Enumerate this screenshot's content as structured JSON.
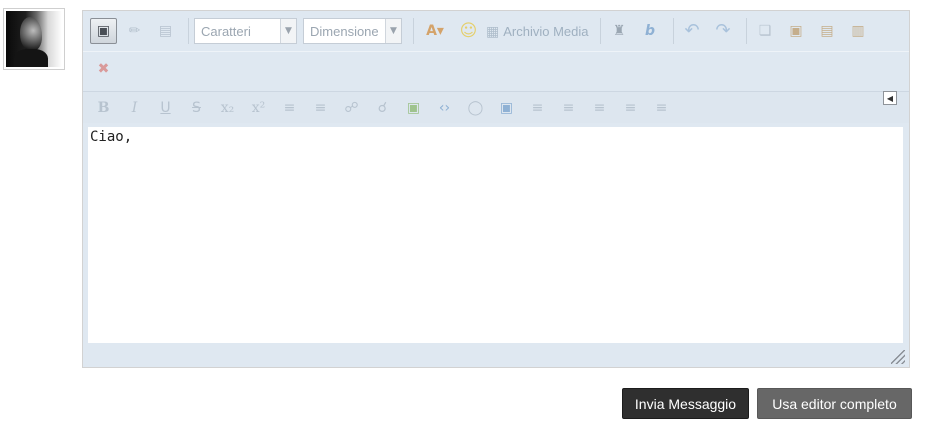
{
  "toolbar": {
    "row1": {
      "font_combo": "Caratteri",
      "size_combo": "Dimensione",
      "media_label": "Archivio Media"
    }
  },
  "editor": {
    "content": "Ciao,"
  },
  "actions": {
    "send_label": "Invia Messaggio",
    "full_editor_label": "Usa editor completo"
  },
  "icons": {
    "source": "source-mode-icon",
    "eraser": "remove-format-icon",
    "table": "table-icon",
    "font_color": "font-color-icon",
    "smiley": "smiley-icon",
    "media": "media-library-icon",
    "anchor": "anchor-icon",
    "abbr": "abbreviation-icon",
    "undo": "undo-icon",
    "redo": "redo-icon",
    "copy": "copy-icon",
    "paste": "paste-icon",
    "paste_text": "paste-text-icon",
    "paste_word": "paste-word-icon",
    "spellcheck": "spellcheck-icon"
  },
  "colors": {
    "toolbar_bg": "#dfe8f1",
    "send_button": "#2f2f2f",
    "full_editor_button": "#676767"
  }
}
